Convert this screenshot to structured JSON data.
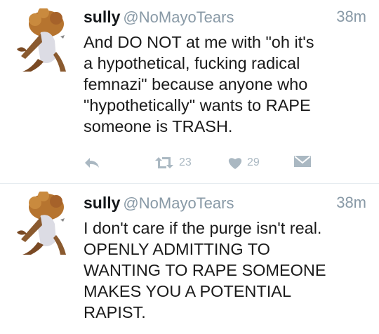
{
  "colors": {
    "meta": "#8899a6",
    "action": "#aab8c2",
    "text": "#1a1a1a",
    "divider": "#e6ecf0"
  },
  "tweets": [
    {
      "name": "sully",
      "handle": "@NoMayoTears",
      "time": "38m",
      "text": "And DO NOT at me with \"oh it's\na hypothetical, fucking radical\nfemnazi\" because anyone who\n\"hypothetically\" wants to RAPE\nsomeone is TRASH.",
      "actions": {
        "reply_icon": "reply-arrow-icon",
        "retweet_icon": "retweet-icon",
        "retweets": "23",
        "like_icon": "heart-icon",
        "likes": "29",
        "dm_icon": "envelope-icon"
      }
    },
    {
      "name": "sully",
      "handle": "@NoMayoTears",
      "time": "38m",
      "text": "I don't care if the purge isn't real.\nOPENLY ADMITTING TO\nWANTING TO RAPE SOMEONE\nMAKES YOU A POTENTIAL\nRAPIST."
    }
  ]
}
